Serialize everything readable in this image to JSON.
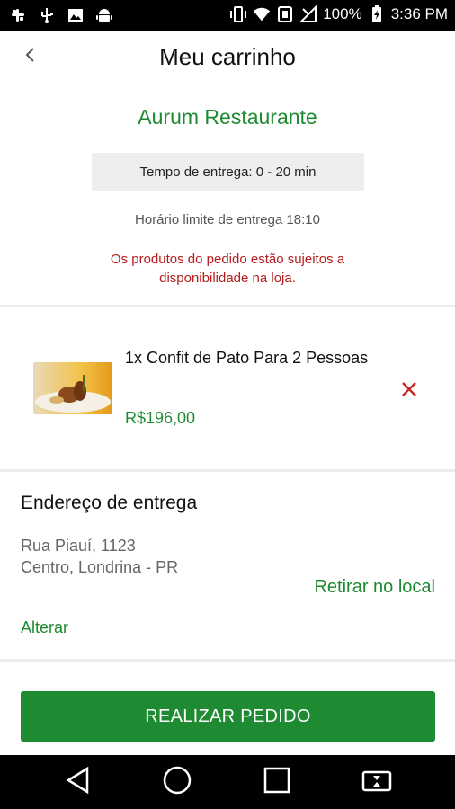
{
  "status_bar": {
    "battery": "100%",
    "time": "3:36 PM",
    "icons": [
      "slack-icon",
      "usb-icon",
      "image-icon",
      "android-icon",
      "vibrate-icon",
      "wifi-icon",
      "nfc-icon",
      "signal-icon",
      "battery-icon"
    ]
  },
  "header": {
    "title": "Meu carrinho",
    "back_icon": "chevron-left-icon"
  },
  "restaurant": {
    "name": "Aurum Restaurante",
    "delivery_time": "Tempo de entrega: 0 - 20 min",
    "limit_time": "Horário limite de entrega 18:10",
    "warning": "Os produtos do pedido estão sujeitos a disponibilidade na loja."
  },
  "cart": {
    "items": [
      {
        "name": "1x Confit de Pato Para 2 Pessoas",
        "price": "R$196,00",
        "remove_icon": "close-icon"
      }
    ]
  },
  "address": {
    "title": "Endereço de entrega",
    "line1": "Rua Piauí, 1123",
    "line2": "Centro, Londrina - PR",
    "pickup_label": "Retirar no local",
    "change_label": "Alterar"
  },
  "actions": {
    "order_label": "REALIZAR PEDIDO"
  },
  "navbar": {
    "icons": [
      "back-triangle-icon",
      "home-circle-icon",
      "recents-square-icon",
      "switch-apps-icon"
    ]
  },
  "colors": {
    "accent": "#1e8a32",
    "warning": "#b71c1c",
    "remove": "#c62828"
  }
}
